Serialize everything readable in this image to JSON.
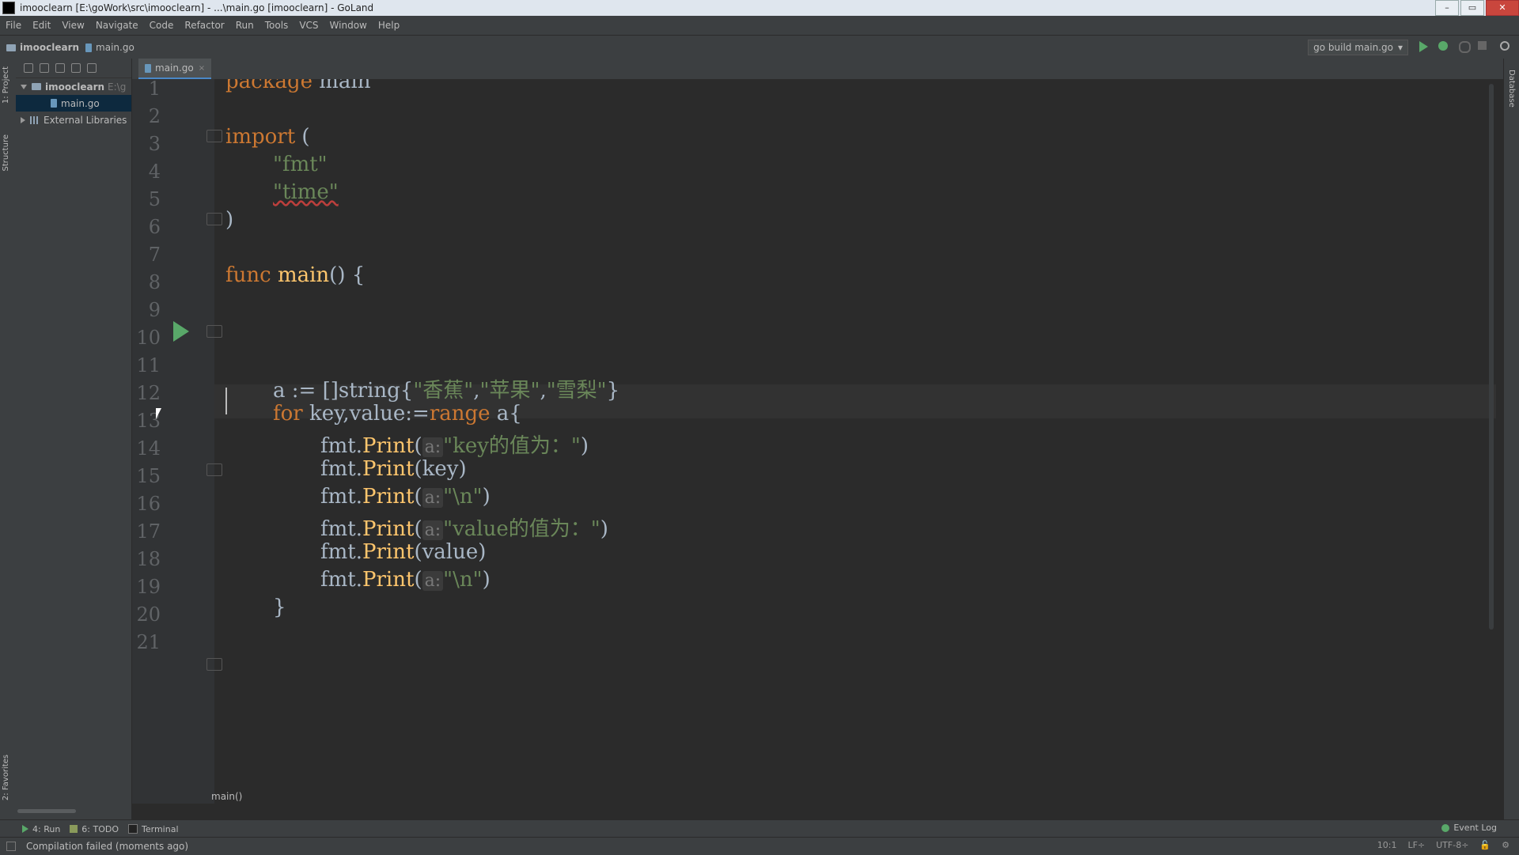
{
  "window": {
    "title": "imooclearn [E:\\goWork\\src\\imooclearn] - ...\\main.go [imooclearn] - GoLand",
    "controls": [
      "–",
      "▭",
      "✕"
    ]
  },
  "menu": [
    "File",
    "Edit",
    "View",
    "Navigate",
    "Code",
    "Refactor",
    "Run",
    "Tools",
    "VCS",
    "Window",
    "Help"
  ],
  "navbar": {
    "project": "imooclearn",
    "file": "main.go",
    "run_config": "go build main.go"
  },
  "left_strip": {
    "project": "1: Project",
    "structure": "Structure",
    "favorites": "2: Favorites"
  },
  "right_strip": {
    "database": "Database"
  },
  "project_tree": {
    "root": "imooclearn",
    "root_path": "E:\\g",
    "file": "main.go",
    "libraries": "External Libraries"
  },
  "tab": {
    "label": "main.go",
    "close": "×"
  },
  "editor": {
    "line_numbers": [
      "1",
      "2",
      "3",
      "4",
      "5",
      "6",
      "7",
      "8",
      "9",
      "10",
      "11",
      "12",
      "13",
      "14",
      "15",
      "16",
      "17",
      "18",
      "19",
      "20",
      "21"
    ],
    "line1": {
      "kw": "package",
      "rest": " main"
    },
    "line3": {
      "kw": "import",
      "rest": " ("
    },
    "line4": "\"fmt\"",
    "line5": "\"time\"",
    "line6": ")",
    "line8": {
      "kw": "func",
      "name": " main",
      "rest": "() {"
    },
    "line12": {
      "pre": "a := []string{",
      "s1": "\"香蕉\"",
      "c1": ",",
      "s2": "\"苹果\"",
      "c2": ",",
      "s3": "\"雪梨\"",
      "post": "}"
    },
    "line13": {
      "kw": "for",
      "mid": " key,value:=",
      "kw2": "range",
      "post": " a{"
    },
    "calls": {
      "obj": "fmt.",
      "fn": "Print",
      "hint": "a:",
      "l14_arg": "\"key的值为：\"",
      "l15_arg": "key",
      "l16_arg": "\"\\n\"",
      "l17_arg": "\"value的值为：\"",
      "l18_arg": "value",
      "l19_arg": "\"\\n\""
    },
    "line20": "}",
    "breadcrumb": "main()"
  },
  "toolwindows": {
    "run": "4: Run",
    "todo": "6: TODO",
    "terminal": "Terminal"
  },
  "status": {
    "message": "Compilation failed (moments ago)",
    "position": "10:1",
    "line_sep": "LF÷",
    "encoding": "UTF-8÷",
    "event_log": "Event Log"
  },
  "colors": {
    "keyword": "#cc7832",
    "string": "#6a8759",
    "function": "#ffc66d",
    "text": "#a9b7c6",
    "run": "#59a869"
  }
}
